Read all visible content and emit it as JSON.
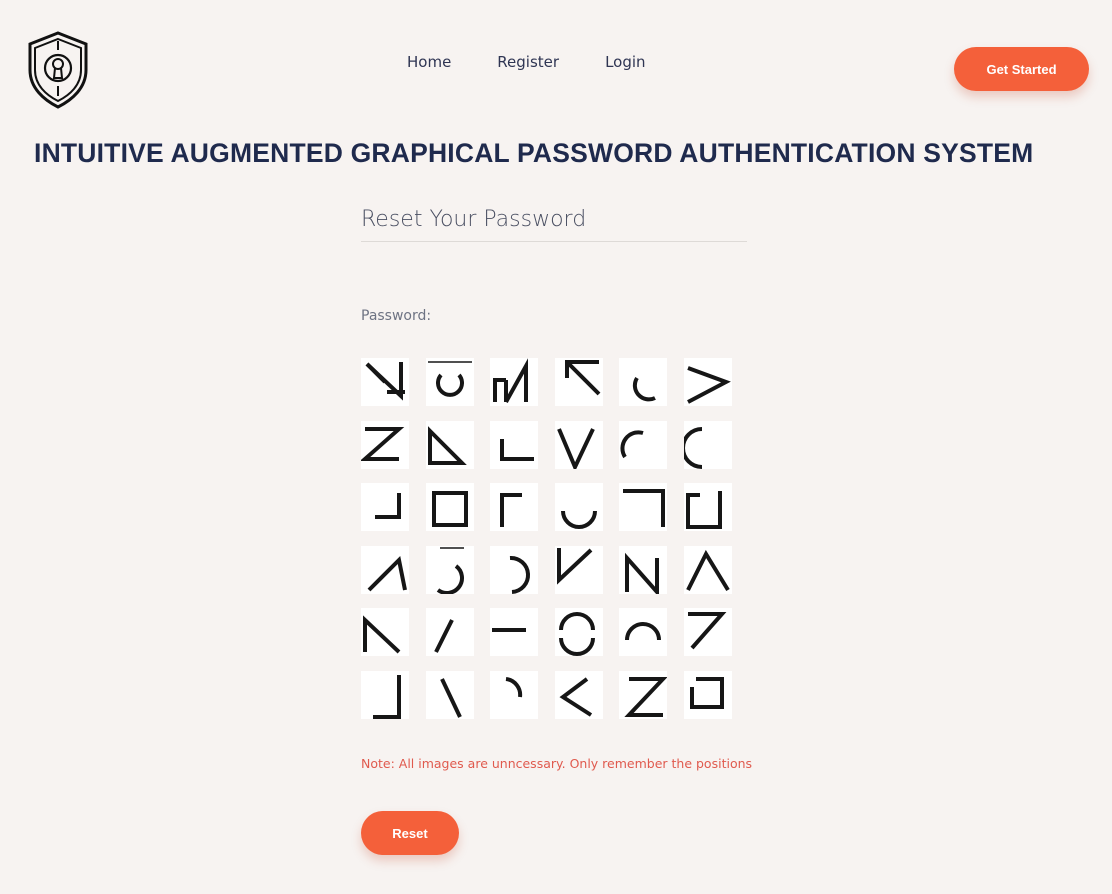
{
  "nav": {
    "items": [
      "Home",
      "Register",
      "Login"
    ],
    "cta_label": "Get Started"
  },
  "page": {
    "title": "INTUITIVE AUGMENTED GRAPHICAL PASSWORD AUTHENTICATION SYSTEM"
  },
  "form": {
    "heading": "Reset Your Password",
    "password_label": "Password:",
    "note": "Note: All images are unncessary. Only remember the positions",
    "submit_label": "Reset"
  },
  "colors": {
    "accent": "#f4603a",
    "background": "#f7f3f1",
    "heading": "#1f2a4d",
    "note": "#e05a4e"
  },
  "grid": {
    "rows": 6,
    "cols": 6,
    "tiles": [
      [
        "diag-corner-v",
        "circle-gap-top",
        "n-shape",
        "reverse-z-top",
        "arc-left-bottom",
        "greater-than"
      ],
      [
        "z-shape",
        "diag-bottom-line",
        "l-corner-bottom-left",
        "v-shape",
        "arc-top-left",
        "arc-left"
      ],
      [
        "corner-bottom-right",
        "square",
        "corner-top-left",
        "u-arc",
        "corner-top-right",
        "square-open-right"
      ],
      [
        "lambda-left",
        "arc-right-bottom",
        "arc-right",
        "check-v",
        "n-letter",
        "caret-up"
      ],
      [
        "lambda-right",
        "slash",
        "dash",
        "circle-gap-sides",
        "arc-top",
        "seven"
      ],
      [
        "corner-bottom-right-tall",
        "backslash",
        "arc-top-right",
        "less-than",
        "z-reverse",
        "square-open-left"
      ]
    ]
  }
}
